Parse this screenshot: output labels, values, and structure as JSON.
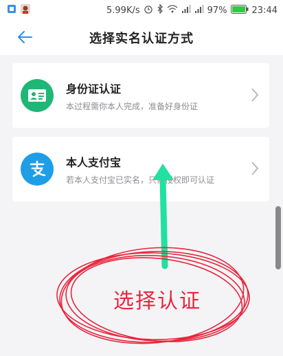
{
  "status_bar": {
    "speed": "5.99K/s",
    "battery_percent": "97%",
    "time": "23:44",
    "icons": [
      "app-notification-icon",
      "avatar-notification-icon",
      "alarm-icon",
      "bluetooth-icon",
      "wifi-icon",
      "signal-icon",
      "signal-icon",
      "battery-icon"
    ]
  },
  "header": {
    "title": "选择实名认证方式",
    "back_icon": "back-arrow-icon"
  },
  "options": [
    {
      "title": "身份证认证",
      "desc": "本过程需你本人完成，准备好身份证",
      "icon": "id-card-icon",
      "icon_color": "#1fb777"
    },
    {
      "title": "本人支付宝",
      "desc": "若本人支付宝已实名，只需授权即可认证",
      "icon": "alipay-icon",
      "icon_color": "#1f9ee8"
    }
  ],
  "annotation": {
    "text": "选择认证",
    "arrow_color": "#22e0a0",
    "circle_color": "#e8253c"
  }
}
